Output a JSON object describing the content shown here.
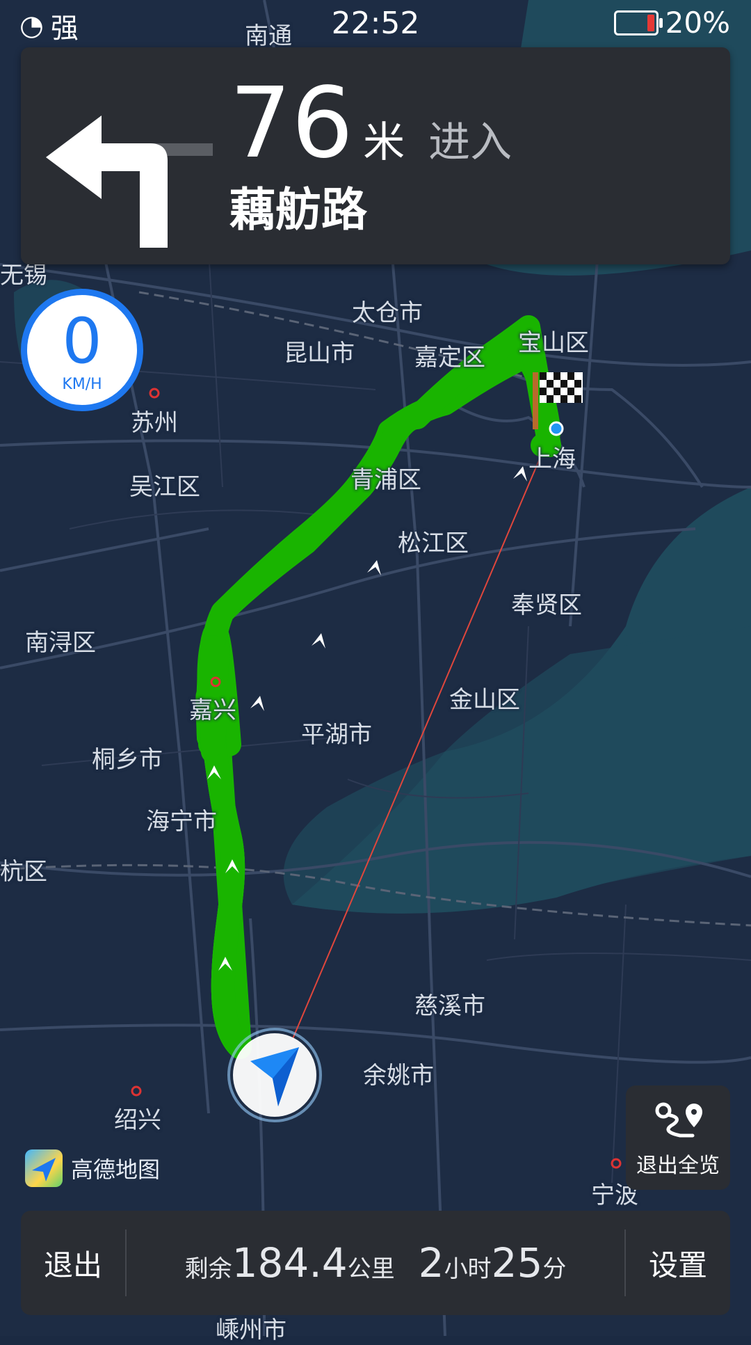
{
  "status_bar": {
    "signal_text": "强",
    "time": "22:52",
    "battery": "20%"
  },
  "guidance": {
    "turn_icon": "turn-left-icon",
    "distance": "76",
    "unit": "米",
    "action": "进入",
    "road": "藕舫路"
  },
  "speed": {
    "value": "0",
    "unit": "KM/H"
  },
  "map_labels": [
    {
      "id": "taicang",
      "text": "太仓市"
    },
    {
      "id": "kunshan",
      "text": "昆山市"
    },
    {
      "id": "jiading",
      "text": "嘉定区"
    },
    {
      "id": "baoshan",
      "text": "宝山区"
    },
    {
      "id": "suzhou",
      "text": "苏州"
    },
    {
      "id": "wujiang",
      "text": "吴江区"
    },
    {
      "id": "qingpu",
      "text": "青浦区"
    },
    {
      "id": "shanghai",
      "text": "上海"
    },
    {
      "id": "songjiang",
      "text": "松江区"
    },
    {
      "id": "fengxian",
      "text": "奉贤区"
    },
    {
      "id": "nanxun",
      "text": "南浔区"
    },
    {
      "id": "jiaxing",
      "text": "嘉兴"
    },
    {
      "id": "jinshan",
      "text": "金山区"
    },
    {
      "id": "pinghu",
      "text": "平湖市"
    },
    {
      "id": "tongxiang",
      "text": "桐乡市"
    },
    {
      "id": "haining",
      "text": "海宁市"
    },
    {
      "id": "hangqu",
      "text": "杭区"
    },
    {
      "id": "cixi",
      "text": "慈溪市"
    },
    {
      "id": "yuyao",
      "text": "余姚市"
    },
    {
      "id": "shaoxing",
      "text": "绍兴"
    },
    {
      "id": "ningbo",
      "text": "宁波"
    },
    {
      "id": "shengzhou",
      "text": "嵊州市"
    },
    {
      "id": "nantong",
      "text": "南通"
    },
    {
      "id": "wuxi",
      "text": "无锡"
    }
  ],
  "brand": {
    "name": "高德地图"
  },
  "overview_button": {
    "label": "退出全览",
    "icon": "route-overview-icon"
  },
  "bottom_bar": {
    "exit_label": "退出",
    "remaining_prefix": "剩余",
    "remaining_distance": "184.4",
    "distance_unit": "公里",
    "hours": "2",
    "hours_unit": "小时",
    "minutes": "25",
    "minutes_unit": "分",
    "settings_label": "设置"
  },
  "colors": {
    "route": "#19b400",
    "water": "#1d4a5a",
    "land": "#1b2a42",
    "accent": "#1e78f0"
  }
}
